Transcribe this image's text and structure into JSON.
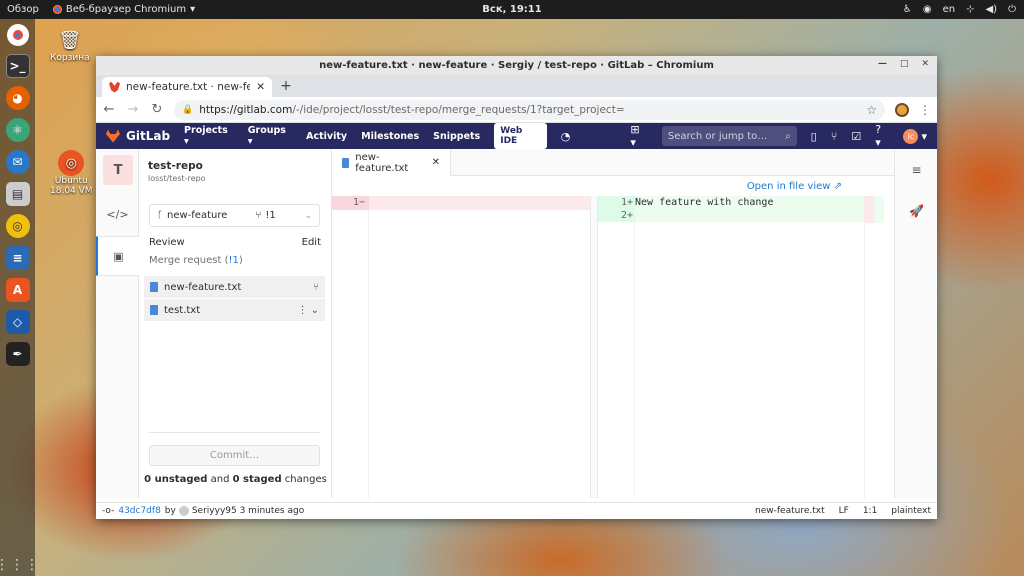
{
  "topbar": {
    "overview": "Обзор",
    "app_name": "Веб-браузер Chromium",
    "clock": "Вск, 19:11",
    "lang": "en"
  },
  "desktop": {
    "trash_label": "Корзина",
    "ubuntu_label": "Ubuntu",
    "ubuntu_time": "18.04 VM"
  },
  "window": {
    "title": "new-feature.txt · new-feature · Sergiy / test-repo · GitLab – Chromium",
    "tab_title": "new-feature.txt · new-fea",
    "url_host": "https://gitlab.com",
    "url_rest": "/-/ide/project/losst/test-repo/merge_requests/1?target_project="
  },
  "gitlab": {
    "brand": "GitLab",
    "nav": [
      "Projects",
      "Groups",
      "Activity",
      "Milestones",
      "Snippets"
    ],
    "web_ide": "Web IDE",
    "search_placeholder": "Search or jump to…"
  },
  "ide": {
    "project_initial": "T",
    "project_name": "test-repo",
    "project_path": "losst/test-repo",
    "branch": "new-feature",
    "mr_count": "!1",
    "review_label": "Review",
    "edit_label": "Edit",
    "mr_text": "Merge request (",
    "mr_link": "!1",
    "mr_close": ")",
    "files": [
      "new-feature.txt",
      "test.txt"
    ],
    "commit_button": "Commit…",
    "changes": {
      "unstaged_count": "0 unstaged",
      "and": " and ",
      "staged_count": "0 staged",
      "suffix": " changes"
    },
    "editor_tab": "new-feature.txt",
    "open_file_view": "Open in file view",
    "diff": {
      "left_line": "1−",
      "right_lines": [
        {
          "num": "1+",
          "code": "New feature with change"
        },
        {
          "num": "2+",
          "code": ""
        }
      ]
    }
  },
  "statusbar": {
    "sha": "43dc7df8",
    "by": "by",
    "author_time": "Seriyyy95 3 minutes ago",
    "file": "new-feature.txt",
    "eol": "LF",
    "pos": "1:1",
    "lang": "plaintext"
  }
}
